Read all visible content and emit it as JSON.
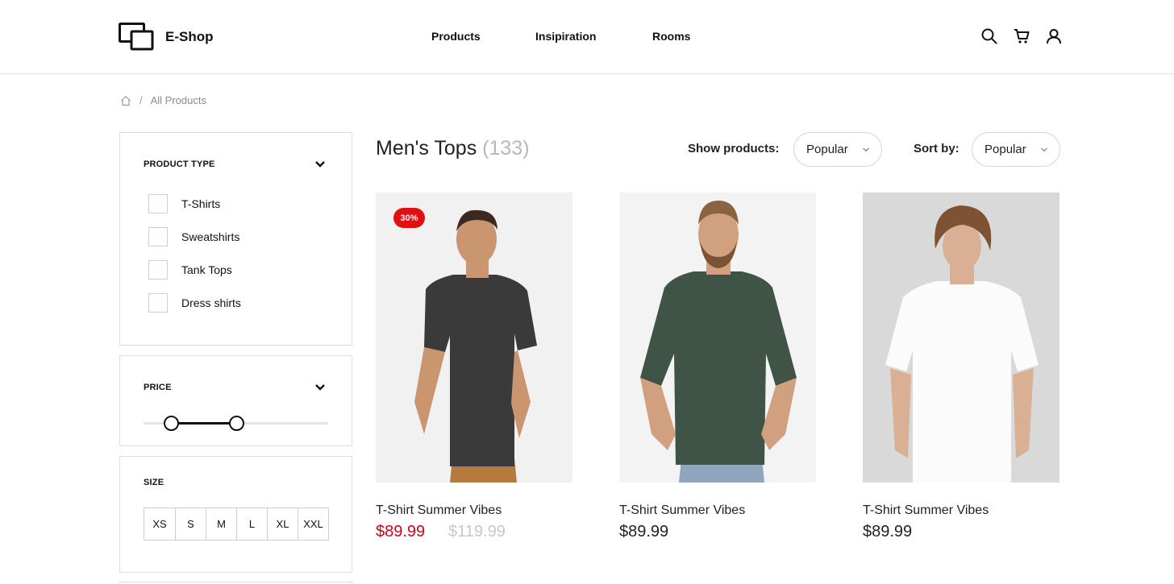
{
  "brand": {
    "name": "E-Shop"
  },
  "nav": {
    "items": [
      "Products",
      "Insipiration",
      "Rooms"
    ]
  },
  "header_icons": [
    "search-icon",
    "cart-icon",
    "user-icon"
  ],
  "breadcrumb": {
    "current": "All Products",
    "separator": "/"
  },
  "filters": {
    "product_type": {
      "title": "PRODUCT TYPE",
      "options": [
        "T-Shirts",
        "Sweatshirts",
        "Tank Tops",
        "Dress shirts"
      ]
    },
    "price": {
      "title": "PRICE",
      "range_low": 0.15,
      "range_high": 0.5
    },
    "size": {
      "title": "SIZE",
      "options": [
        "XS",
        "S",
        "M",
        "L",
        "XL",
        "XXL"
      ]
    }
  },
  "listing": {
    "title": "Men's Tops",
    "count": "(133)",
    "show_label": "Show products:",
    "show_value": "Popular",
    "sort_label": "Sort by:",
    "sort_value": "Popular"
  },
  "products": [
    {
      "name": "T-Shirt Summer Vibes",
      "price": "$89.99",
      "old_price": "$119.99",
      "badge": "30%",
      "shirt_color": "#3a3a3a",
      "bg": "#f1f1f1"
    },
    {
      "name": "T-Shirt Summer Vibes",
      "price": "$89.99",
      "shirt_color": "#3f5446",
      "bg": "#f3f3f3"
    },
    {
      "name": "T-Shirt Summer Vibes",
      "price": "$89.99",
      "shirt_color": "#fbfbfb",
      "bg": "#d9d9d9"
    }
  ],
  "colors": {
    "accent_sale": "#d0021b",
    "badge": "#e01010"
  }
}
